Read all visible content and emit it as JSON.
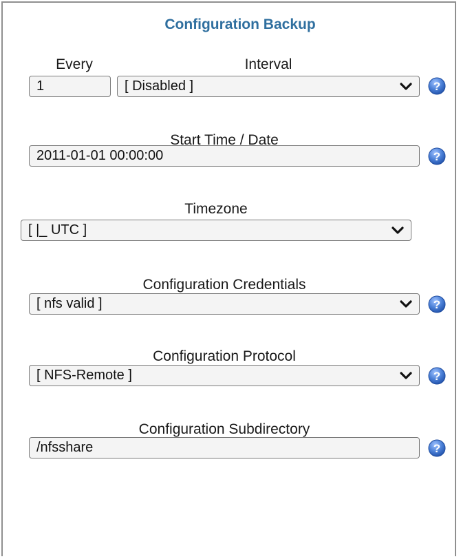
{
  "panel": {
    "title": "Configuration Backup"
  },
  "fields": {
    "every": {
      "label": "Every",
      "value": "1"
    },
    "interval": {
      "label": "Interval",
      "value": "[ Disabled ]"
    },
    "start_time": {
      "label": "Start Time / Date",
      "value": "2011-01-01 00:00:00"
    },
    "timezone": {
      "label": "Timezone",
      "value": "[ |_ UTC ]"
    },
    "credentials": {
      "label": "Configuration Credentials",
      "value": "[ nfs valid ]"
    },
    "protocol": {
      "label": "Configuration Protocol",
      "value": "[ NFS-Remote ]"
    },
    "subdirectory": {
      "label": "Configuration Subdirectory",
      "value": "/nfsshare"
    }
  },
  "icons": {
    "help": "help-icon",
    "dropdown": "chevron-down-icon"
  },
  "colors": {
    "title": "#2f6f9f",
    "help_icon": "#4a7fd6",
    "panel_border": "#8f8f8f",
    "field_background": "#f4f4f4"
  }
}
